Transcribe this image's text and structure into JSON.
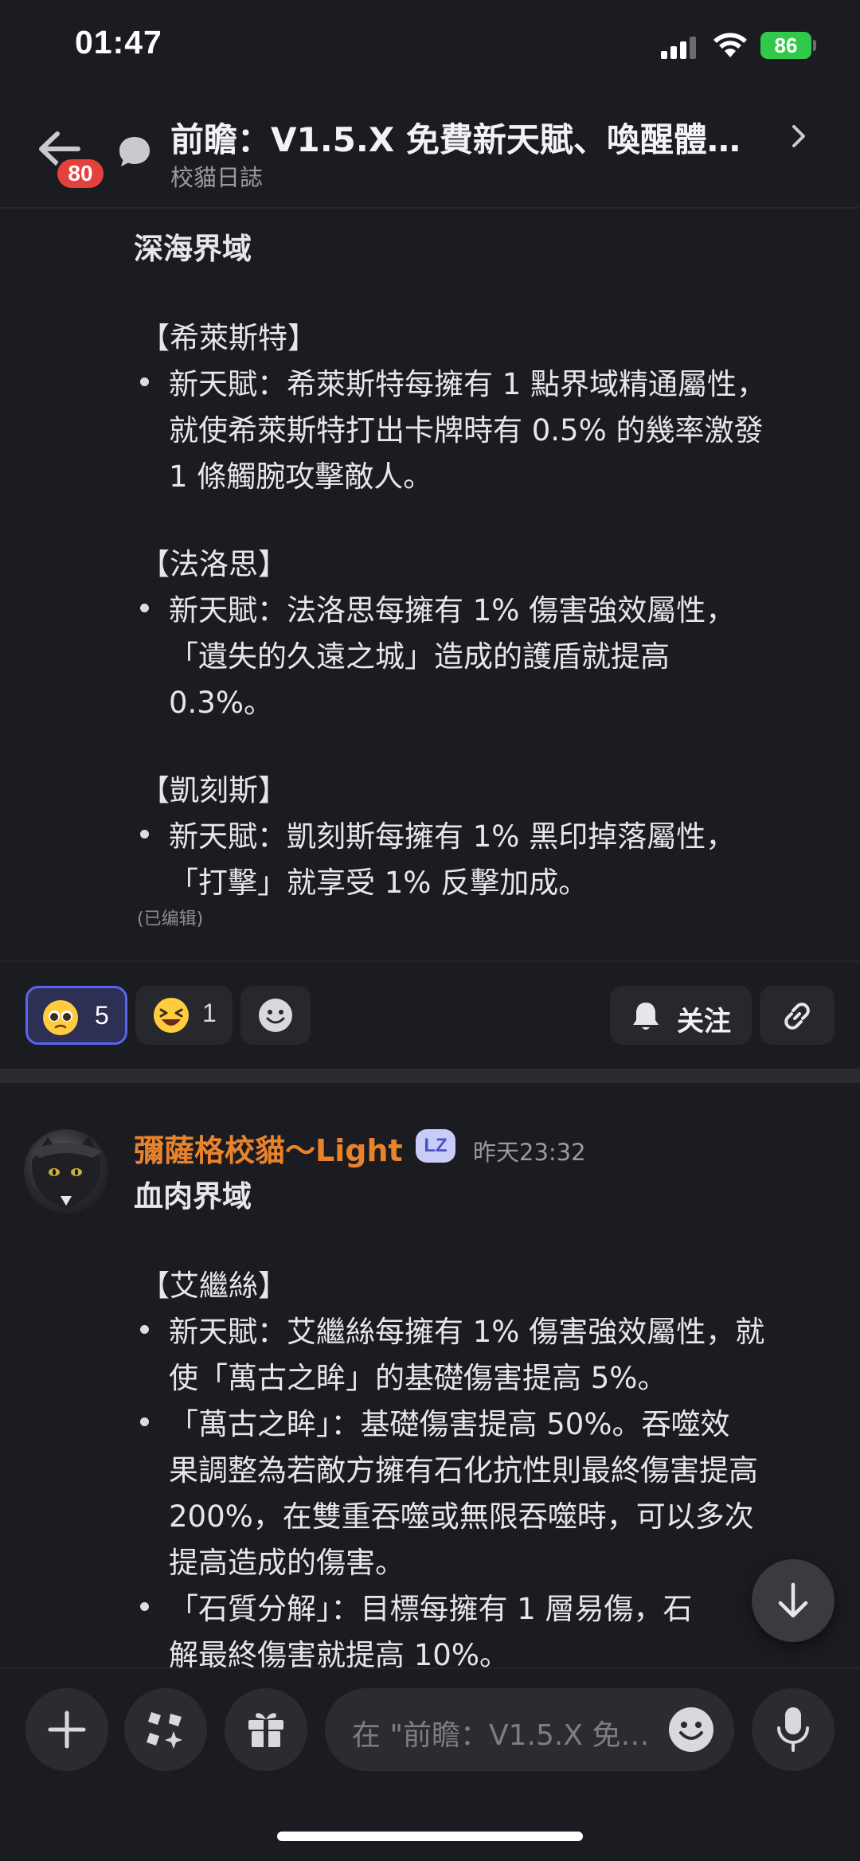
{
  "status_bar": {
    "time": "01:47",
    "battery": "86"
  },
  "header": {
    "back_badge": "80",
    "title": "前瞻：V1.5.X 免費新天賦、喚醒體…",
    "subtitle": "校貓日誌"
  },
  "message1": {
    "lines": [
      "深海界域",
      "【希萊斯特】",
      "新天賦：希萊斯特每擁有 1 點界域精通屬性，",
      "就使希萊斯特打出卡牌時有 0.5% 的幾率激發",
      "1 條觸腕攻擊敵人。",
      "【法洛思】",
      "新天賦：法洛思每擁有 1% 傷害強效屬性，",
      "「遺失的久遠之城」造成的護盾就提高",
      "0.3%。",
      "【凱刻斯】",
      "新天賦：凱刻斯每擁有 1% 黑印掉落屬性，",
      "「打擊」就享受 1% 反擊加成。"
    ],
    "edited": "(已编辑)"
  },
  "reactions": [
    {
      "emoji": "pleading-face-emoji",
      "count": "5",
      "active": true
    },
    {
      "emoji": "laughing-face-emoji",
      "count": "1",
      "active": false
    }
  ],
  "actions": {
    "follow": "关注"
  },
  "message2": {
    "author": "彌薩格校貓～Light",
    "role_badge": "LZ",
    "timestamp": "昨天23:32",
    "lines": [
      "血肉界域",
      "【艾繼絲】",
      "新天賦：艾繼絲每擁有 1% 傷害強效屬性，就",
      "使「萬古之眸」的基礎傷害提高 5%。",
      "「萬古之眸」：基礎傷害提高 50%。吞噬效",
      "果調整為若敵方擁有石化抗性則最終傷害提高",
      "200%，在雙重吞噬或無限吞噬時，可以多次",
      "提高造成的傷害。",
      "「石質分解」：目標每擁有 1 層易傷，石",
      "解最終傷害就提高 10%。"
    ]
  },
  "composer": {
    "placeholder": "在 \"前瞻：V1.5.X 免…"
  },
  "colors": {
    "accent": "#5865f2",
    "username": "#e8832b",
    "badge_red": "#e4403c",
    "battery": "#31c94a"
  }
}
